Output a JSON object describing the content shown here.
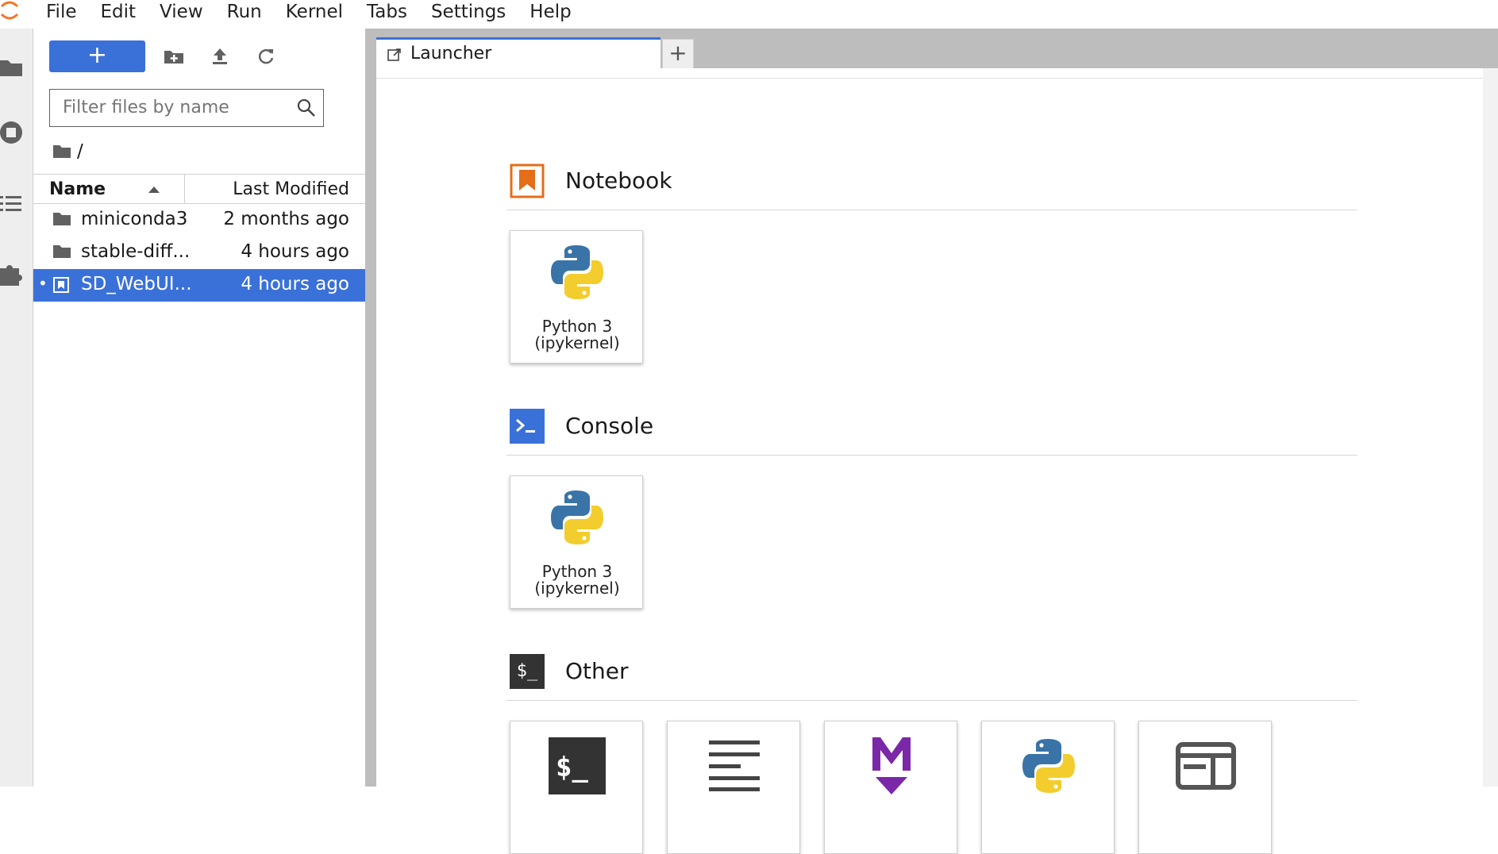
{
  "menubar": {
    "items": [
      "File",
      "Edit",
      "View",
      "Run",
      "Kernel",
      "Tabs",
      "Settings",
      "Help"
    ]
  },
  "filebrowser": {
    "new_button_label": "+",
    "filter_placeholder": "Filter files by name",
    "breadcrumb": "/",
    "columns": {
      "name": "Name",
      "modified": "Last Modified"
    },
    "files": [
      {
        "name": "miniconda3",
        "modified": "2 months ago",
        "type": "folder",
        "selected": false
      },
      {
        "name": "stable-diff...",
        "modified": "4 hours ago",
        "type": "folder",
        "selected": false
      },
      {
        "name": "SD_WebUI...",
        "modified": "4 hours ago",
        "type": "notebook",
        "selected": true
      }
    ]
  },
  "tabs": {
    "active_label": "Launcher",
    "add_label": "+"
  },
  "launcher": {
    "notebook": {
      "title": "Notebook",
      "cards": [
        {
          "line1": "Python 3",
          "line2": "(ipykernel)"
        }
      ]
    },
    "console": {
      "title": "Console",
      "cards": [
        {
          "line1": "Python 3",
          "line2": "(ipykernel)"
        }
      ]
    },
    "other": {
      "title": "Other",
      "icon_text": "$_",
      "cards": [
        "terminal-icon",
        "text-file-icon",
        "markdown-icon",
        "python-file-icon",
        "show-contextual-help-icon"
      ]
    }
  },
  "colors": {
    "accent": "#3a71d8",
    "notebook_orange": "#e46e1a",
    "console_blue": "#3a71d8",
    "markdown_purple": "#7b28a8"
  }
}
